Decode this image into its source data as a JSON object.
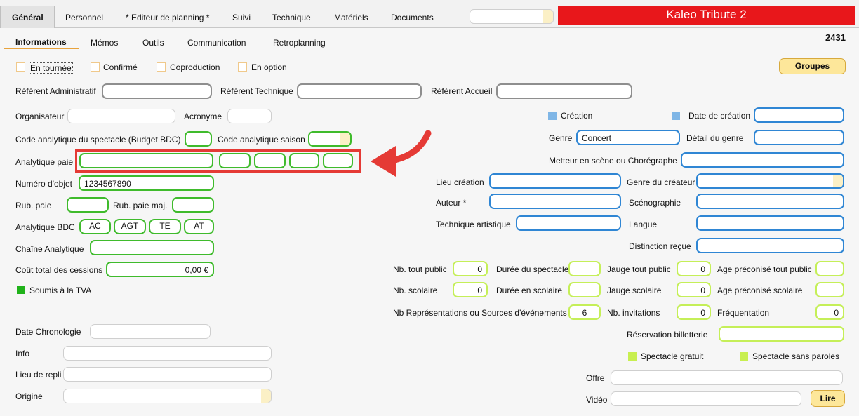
{
  "tabs_main": [
    "Général",
    "Personnel",
    "* Editeur de planning *",
    "Suivi",
    "Technique",
    "Matériels",
    "Documents"
  ],
  "tabs_sub": [
    "Informations",
    "Mémos",
    "Outils",
    "Communication",
    "Retroplanning"
  ],
  "show_title": "Kaleo Tribute 2",
  "record_number": "2431",
  "checkboxes": {
    "en_tournee": "En tournée",
    "confirme": "Confirmé",
    "coproduction": "Coproduction",
    "en_option": "En option"
  },
  "buttons": {
    "groupes": "Groupes",
    "lire": "Lire"
  },
  "referents": {
    "administratif": "Référent Administratif",
    "technique": "Référent Technique",
    "accueil": "Référent Accueil"
  },
  "left": {
    "organisateur": "Organisateur",
    "acronyme": "Acronyme",
    "code_spectacle": "Code analytique du spectacle (Budget BDC)",
    "code_saison": "Code analytique saison",
    "analytique_paie": "Analytique paie",
    "numero_objet": "Numéro d'objet",
    "numero_objet_value": "1234567890",
    "rub_paie": "Rub. paie",
    "rub_paie_maj": "Rub. paie maj.",
    "analytique_bdc": "Analytique BDC",
    "bdc_codes": [
      "AC",
      "AGT",
      "TE",
      "AT"
    ],
    "chaine": "Chaîne Analytique",
    "cout_total": "Coût total des cessions",
    "cout_value": "0,00 €",
    "soumis_tva": "Soumis à la TVA",
    "date_chrono": "Date Chronologie",
    "info": "Info",
    "lieu_repli": "Lieu de repli",
    "origine": "Origine"
  },
  "right": {
    "creation": "Création",
    "date_creation": "Date de création",
    "genre": "Genre",
    "genre_value": "Concert",
    "detail_genre": "Détail du genre",
    "metteur": "Metteur en scène ou Chorégraphe",
    "lieu_creation": "Lieu création",
    "genre_createur": "Genre du créateur",
    "auteur": "Auteur *",
    "scenographie": "Scénographie",
    "technique_artistique": "Technique artistique",
    "langue": "Langue",
    "distinction": "Distinction reçue"
  },
  "stats": {
    "nb_tout_public": "Nb. tout public",
    "nb_tout_public_value": "0",
    "duree_spectacle": "Durée du spectacle",
    "jauge_tout_public": "Jauge tout public",
    "jauge_tout_public_value": "0",
    "age_tout_public": "Age préconisé tout public",
    "nb_scolaire": "Nb. scolaire",
    "nb_scolaire_value": "0",
    "duree_scolaire": "Durée en scolaire",
    "jauge_scolaire": "Jauge scolaire",
    "jauge_scolaire_value": "0",
    "age_scolaire": "Age préconisé scolaire",
    "nb_representations": "Nb Représentations ou Sources d'événements",
    "nb_representations_value": "6",
    "nb_invitations": "Nb. invitations",
    "nb_invitations_value": "0",
    "frequentation": "Fréquentation",
    "frequentation_value": "0",
    "reservation": "Réservation billetterie",
    "spectacle_gratuit": "Spectacle gratuit",
    "spectacle_sans_paroles": "Spectacle sans paroles",
    "offre": "Offre",
    "video": "Vidéo"
  },
  "colors": {
    "green_border": "#3fbb2c",
    "blue_border": "#2f86d4",
    "title_red": "#e8171b",
    "highlight_red": "#e53a35",
    "button_yellow": "#fde79a"
  }
}
